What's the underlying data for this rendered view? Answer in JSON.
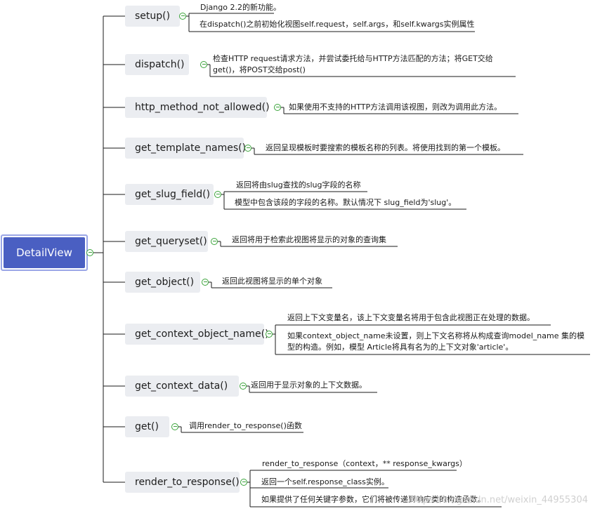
{
  "root": {
    "label": "DetailView"
  },
  "methods": [
    {
      "name": "setup()",
      "details": [
        "Django 2.2的新功能。",
        "在dispatch()之前初始化视图self.request，self.args，和self.kwargs实例属性"
      ]
    },
    {
      "name": "dispatch()",
      "details": [
        "检查HTTP request请求方法，并尝试委托给与HTTP方法匹配的方法；将GET交给get()，将POST交给post()"
      ]
    },
    {
      "name": "http_method_not_allowed()",
      "details": [
        "如果使用不支持的HTTP方法调用该视图，则改为调用此方法。"
      ]
    },
    {
      "name": "get_template_names()",
      "details": [
        "返回呈现模板时要搜索的模板名称的列表。将使用找到的第一个模板。"
      ]
    },
    {
      "name": "get_slug_field()",
      "details": [
        "返回将由slug查找的slug字段的名称",
        "模型中包含该段的字段的名称。默认情况下 slug_field为'slug'。"
      ]
    },
    {
      "name": "get_queryset()",
      "details": [
        "返回将用于检索此视图将显示的对象的查询集"
      ]
    },
    {
      "name": "get_object()",
      "details": [
        "返回此视图将显示的单个对象"
      ]
    },
    {
      "name": "get_context_object_name()",
      "details": [
        "返回上下文变量名，该上下文变量名将用于包含此视图正在处理的数据。",
        "如果context_object_name未设置，则上下文名称将从构成查询model_name 集的模型的构造。例如，模型 Article将具有名为的上下文对象'article'。"
      ]
    },
    {
      "name": "get_context_data()",
      "details": [
        "返回用于显示对象的上下文数据。"
      ]
    },
    {
      "name": "get()",
      "details": [
        "调用render_to_response()函数"
      ]
    },
    {
      "name": "render_to_response()",
      "details": [
        "render_to_response（context，** response_kwargs）",
        "返回一个self.response_class实例。",
        "如果提供了任何关键字参数，它们将被传递到响应类的构造函数。"
      ]
    }
  ],
  "watermark": "https://blog.csdn.net/weixin_44955304",
  "colors": {
    "root_fill": "#4a5fc2",
    "root_border": "#9aa6e6",
    "node_fill": "#ebedf1",
    "line": "#1a1a1a",
    "toggle": "#3aa33a"
  }
}
